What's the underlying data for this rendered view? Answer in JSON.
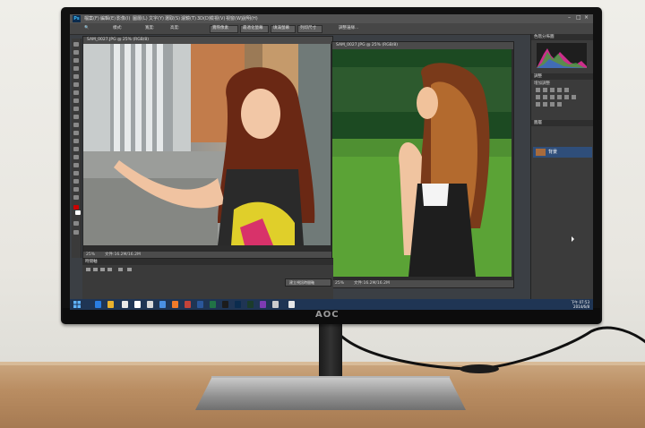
{
  "monitor": {
    "brand": "AOC"
  },
  "photoshop": {
    "app_logo": "Ps",
    "menu": [
      "檔案(F)",
      "編輯(E)",
      "影像(I)",
      "圖層(L)",
      "文字(Y)",
      "選取(S)",
      "濾鏡(T)",
      "3D(D)",
      "檢視(V)",
      "視窗(W)",
      "說明(H)"
    ],
    "options_bar": {
      "items": [
        "樣式:",
        "寬度:",
        "高度:",
        "調整邊緣..."
      ],
      "zoom_buttons": [
        "實際像素",
        "最適化螢幕",
        "填滿螢幕",
        "列印尺寸"
      ]
    },
    "documents": [
      {
        "tab_title": "SAM_0027.JPG @ 25% (RGB/8)",
        "status_zoom": "25%",
        "status_doc": "文件:16.2M/16.2M"
      },
      {
        "tab_title": "SAM_0027.JPG @ 25% (RGB/8)",
        "status_zoom": "25%",
        "status_doc": "文件:16.2M/16.2M"
      }
    ],
    "panels": {
      "histogram_tab": "色階分佈圖",
      "adjustments_tab": "調整",
      "adjustments_label": "增加調整",
      "layers_tab": "圖層",
      "layer_name": "背景"
    },
    "timeline": {
      "title": "時間軸",
      "button_label": "建立視訊時間軸"
    }
  },
  "taskbar": {
    "time": "下午 07:53",
    "date": "2014/6/8"
  }
}
